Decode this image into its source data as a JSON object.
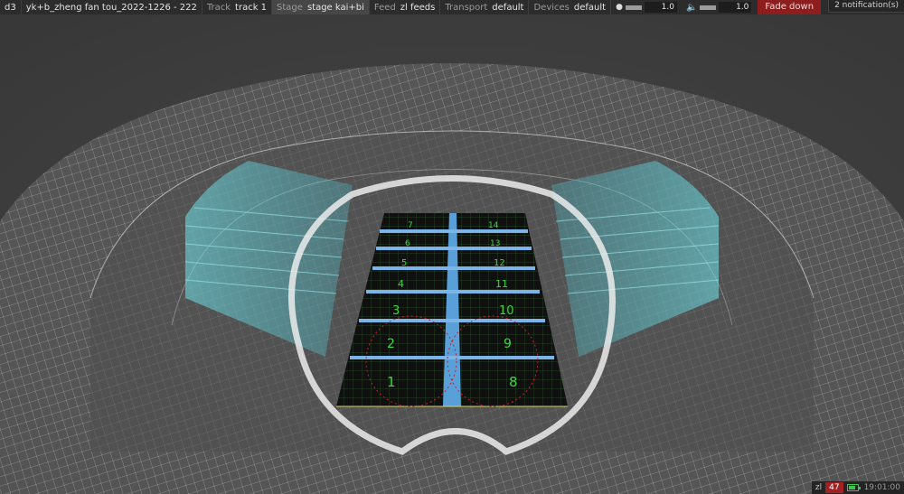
{
  "topbar": {
    "app": "d3",
    "project": "yk+b_zheng fan tou_2022-1226 - 222",
    "track": {
      "label": "Track",
      "value": "track 1"
    },
    "stage": {
      "label": "Stage",
      "value": "stage kai+bi"
    },
    "feed": {
      "label": "Feed",
      "value": "zl feeds"
    },
    "transport": {
      "label": "Transport",
      "value": "default"
    },
    "devices": {
      "label": "Devices",
      "value": "default"
    },
    "brightness_icon": "lightbulb-icon",
    "brightness": {
      "value": "1.0",
      "level": 1.0
    },
    "volume_icon": "speaker-icon",
    "volume": {
      "value": "1.0",
      "level": 1.0
    },
    "fade_label": "Fade down",
    "fade_color": "#8e1d1d"
  },
  "notifications": {
    "label": "2 notification(s)"
  },
  "stage_numbers": {
    "left": [
      "1",
      "2",
      "3",
      "4",
      "5",
      "6",
      "7"
    ],
    "right": [
      "8",
      "9",
      "10",
      "11",
      "12",
      "13",
      "14"
    ],
    "number_color": "#3dd83d"
  },
  "statusbar": {
    "user": "zl",
    "fps": "47",
    "fps_color": "#a02222",
    "battery_level": 0.8,
    "time": "19:01:00"
  }
}
